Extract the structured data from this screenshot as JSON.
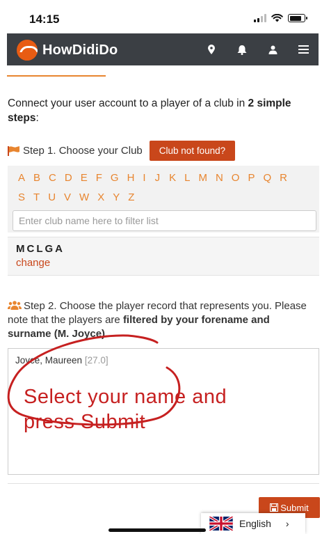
{
  "status_bar": {
    "time": "14:15"
  },
  "navbar": {
    "brand": "HowDidiDo",
    "icons": [
      "location-pin-icon",
      "bell-icon",
      "user-icon",
      "menu-icon"
    ]
  },
  "intro": {
    "text_before": "Connect your user account to a player of a club in ",
    "text_bold": "2 simple steps",
    "text_after": ":"
  },
  "step1": {
    "label": "Step 1. Choose your Club",
    "club_not_found_button": "Club not found?"
  },
  "alphabet_row1": [
    "A",
    "B",
    "C",
    "D",
    "E",
    "F",
    "G",
    "H",
    "I",
    "J",
    "K",
    "L",
    "M",
    "N",
    "O",
    "P",
    "Q",
    "R"
  ],
  "alphabet_row2": [
    "S",
    "T",
    "U",
    "V",
    "W",
    "X",
    "Y",
    "Z"
  ],
  "club_filter": {
    "placeholder": "Enter club name here to filter list"
  },
  "selected_club": {
    "name": "MCLGA",
    "change_link": "change"
  },
  "step2": {
    "text_before": "Step 2. Choose the player record that represents you. Please note that the players are ",
    "text_bold": "filtered by your forename and surname (M. Joyce).",
    "text_after": ""
  },
  "players": [
    {
      "name": "Joyce, Maureen",
      "handicap": "[27.0]"
    }
  ],
  "annotation": {
    "line1": "Select your name and",
    "line2": "press Submit",
    "color": "#c62020"
  },
  "submit_button": "Submit",
  "language": {
    "label": "English"
  },
  "colors": {
    "accent_orange": "#e8852f",
    "button_red": "#c9471b",
    "navbar": "#3b3f44"
  }
}
